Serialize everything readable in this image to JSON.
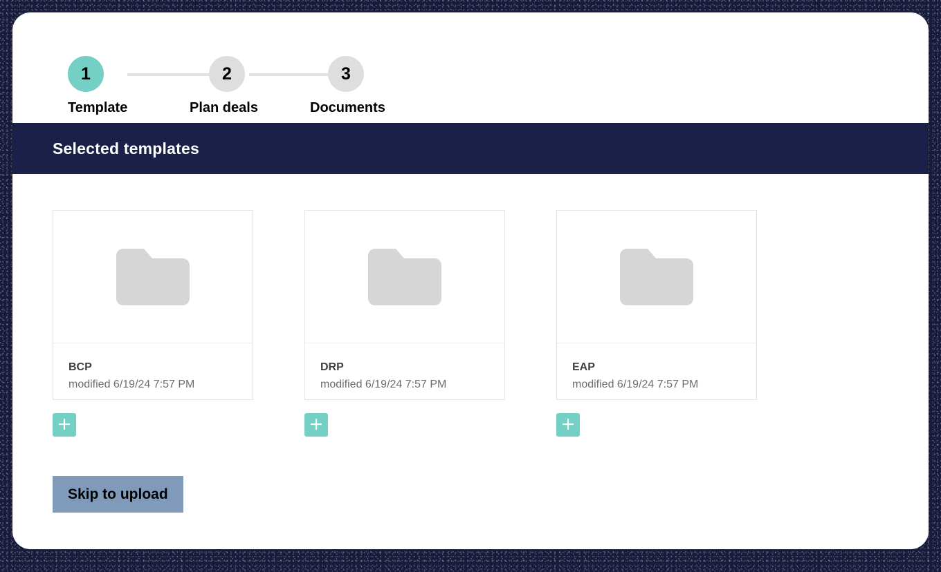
{
  "theme": {
    "backdrop": "#171c3f",
    "sheet_bg": "#ffffff",
    "accent_teal": "#74d0c4",
    "header_navy": "#1b2049",
    "skip_button_bg": "#7f9bb9",
    "step_idle": "#dedede",
    "folder_gray": "#d6d6d6"
  },
  "stepper": {
    "steps": [
      {
        "number": "1",
        "label": "Template",
        "state": "active"
      },
      {
        "number": "2",
        "label": "Plan deals",
        "state": "idle"
      },
      {
        "number": "3",
        "label": "Documents",
        "state": "idle"
      }
    ]
  },
  "section_header": {
    "title": "Selected templates"
  },
  "templates": [
    {
      "name": "BCP",
      "modified": "modified 6/19/24 7:57 PM",
      "icon": "folder-icon",
      "add_icon": "plus-icon"
    },
    {
      "name": "DRP",
      "modified": "modified 6/19/24 7:57 PM",
      "icon": "folder-icon",
      "add_icon": "plus-icon"
    },
    {
      "name": "EAP",
      "modified": "modified 6/19/24 7:57 PM",
      "icon": "folder-icon",
      "add_icon": "plus-icon"
    }
  ],
  "actions": {
    "skip_label": "Skip to upload"
  }
}
